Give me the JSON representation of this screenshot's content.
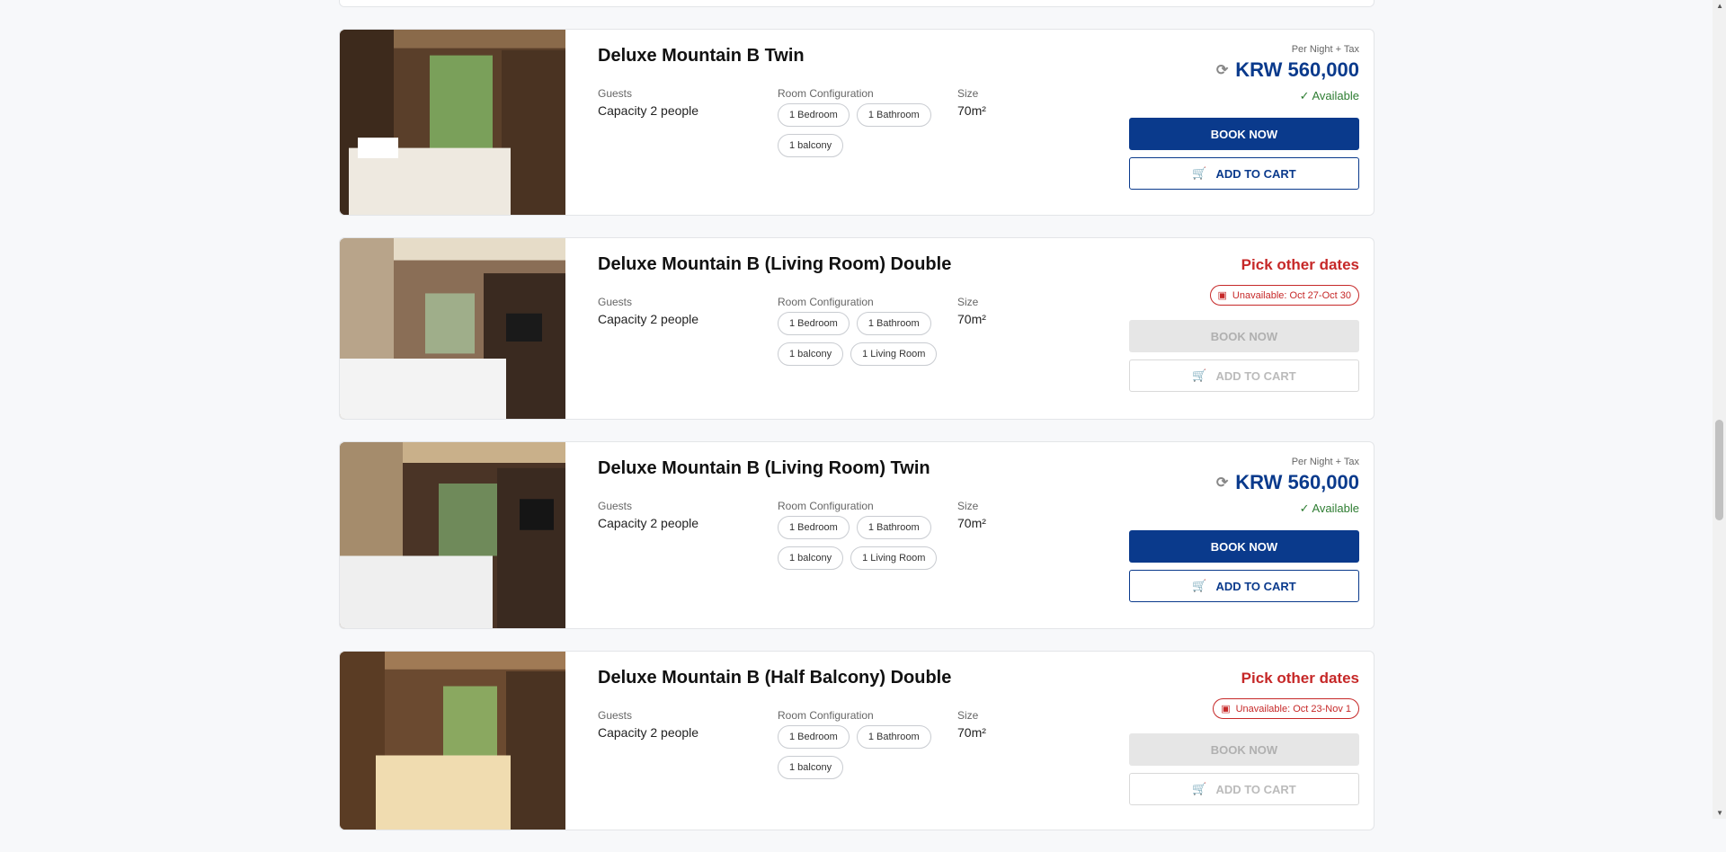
{
  "rooms": [
    {
      "title": "Deluxe Mountain B Twin",
      "guests_label": "Guests",
      "guests": "Capacity 2 people",
      "config_label": "Room Configuration",
      "tags": [
        "1 Bedroom",
        "1 Bathroom",
        "1 balcony"
      ],
      "size_label": "Size",
      "size": "70m²",
      "per_night": "Per Night + Tax",
      "price": "KRW 560,000",
      "status": "Available",
      "book": "BOOK NOW",
      "cart": "ADD TO CART"
    },
    {
      "title": "Deluxe Mountain B (Living Room) Double",
      "guests_label": "Guests",
      "guests": "Capacity 2 people",
      "config_label": "Room Configuration",
      "tags": [
        "1 Bedroom",
        "1 Bathroom",
        "1 balcony",
        "1 Living Room"
      ],
      "size_label": "Size",
      "size": "70m²",
      "pick": "Pick other dates",
      "unavailable": "Unavailable: Oct 27-Oct 30",
      "book": "BOOK NOW",
      "cart": "ADD TO CART"
    },
    {
      "title": "Deluxe Mountain B (Living Room) Twin",
      "guests_label": "Guests",
      "guests": "Capacity 2 people",
      "config_label": "Room Configuration",
      "tags": [
        "1 Bedroom",
        "1 Bathroom",
        "1 balcony",
        "1 Living Room"
      ],
      "size_label": "Size",
      "size": "70m²",
      "per_night": "Per Night + Tax",
      "price": "KRW 560,000",
      "status": "Available",
      "book": "BOOK NOW",
      "cart": "ADD TO CART"
    },
    {
      "title": "Deluxe Mountain B (Half Balcony) Double",
      "guests_label": "Guests",
      "guests": "Capacity 2 people",
      "config_label": "Room Configuration",
      "tags": [
        "1 Bedroom",
        "1 Bathroom",
        "1 balcony"
      ],
      "size_label": "Size",
      "size": "70m²",
      "pick": "Pick other dates",
      "unavailable": "Unavailable: Oct 23-Nov 1",
      "book": "BOOK NOW",
      "cart": "ADD TO CART"
    }
  ],
  "colors": {
    "brand": "#0a3a8c",
    "available": "#2e7d32",
    "unavailable": "#c62828"
  }
}
